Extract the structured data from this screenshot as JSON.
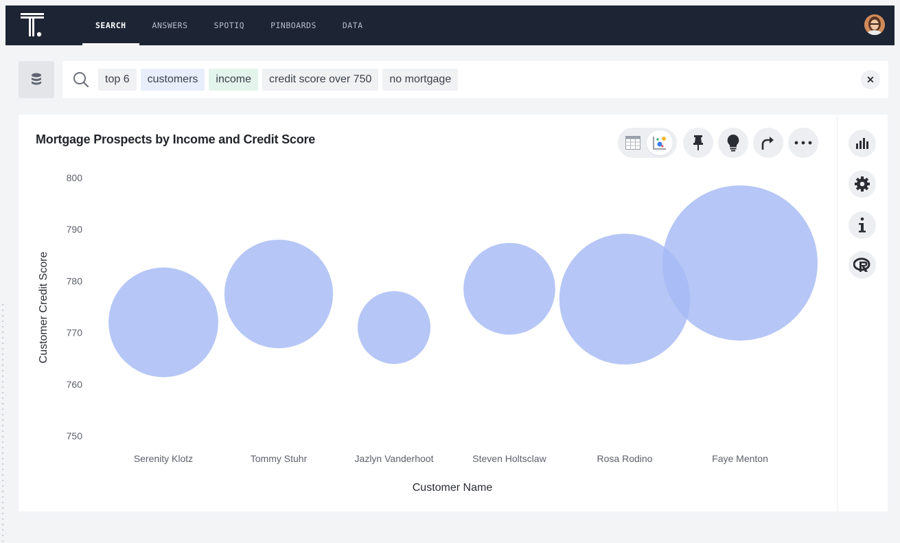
{
  "nav": {
    "tabs": [
      "SEARCH",
      "ANSWERS",
      "SPOTIQ",
      "PINBOARDS",
      "DATA"
    ],
    "active_tab": "SEARCH"
  },
  "search": {
    "tokens": [
      "top 6",
      "customers",
      "income",
      "credit score over 750",
      "no mortgage"
    ]
  },
  "chart": {
    "title": "Mortgage Prospects by Income and Credit Score"
  },
  "icons": {
    "logo": "thoughtspot-logo",
    "user": "avatar",
    "source": "database-icon",
    "search": "search-icon",
    "clear": "close-icon",
    "table_view": "table-icon",
    "chart_view": "scatter-chart-icon",
    "pin": "pin-icon",
    "spotiq": "lightbulb-icon",
    "share": "share-arrow-icon",
    "more": "more-dots-icon",
    "chart_type": "bar-chart-icon",
    "settings": "gear-icon",
    "info": "info-icon",
    "r_analysis": "r-icon"
  },
  "colors": {
    "nav_bg": "#1d2434",
    "bubble": "#a6baf4"
  },
  "chart_data": {
    "type": "scatter",
    "xlabel": "Customer Name",
    "ylabel": "Customer Credit Score",
    "ylim": [
      750,
      800
    ],
    "yticks": [
      800,
      790,
      780,
      770,
      760,
      750
    ],
    "categories": [
      "Serenity Klotz",
      "Tommy Stuhr",
      "Jazlyn Vanderhoot",
      "Steven Holtsclaw",
      "Rosa Rodino",
      "Faye Menton"
    ],
    "y": [
      772,
      777.5,
      771,
      778.5,
      776.5,
      783.5
    ],
    "size": [
      0.5,
      0.49,
      0.22,
      0.35,
      0.71,
      1.0
    ],
    "grid": false,
    "legend": "none"
  }
}
